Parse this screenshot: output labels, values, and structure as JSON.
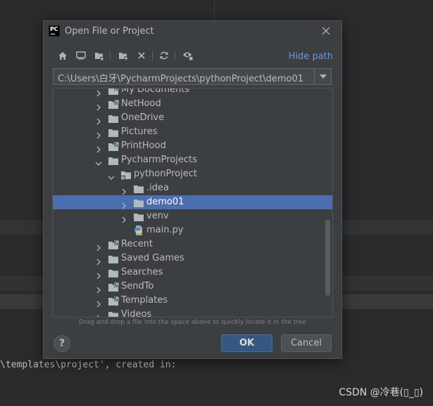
{
  "console": {
    "line": "\\templates\\project', created in:"
  },
  "watermark": "CSDN @冷巷(▯_▯)",
  "dialog": {
    "title": "Open File or Project",
    "logo_text": "PC",
    "hide_path_label": "Hide path",
    "path_value": "C:\\Users\\白牙\\PycharmProjects\\pythonProject\\demo01",
    "tree_hint": "Drag and drop a file into the space above to quickly locate it in the tree",
    "ok_label": "OK",
    "cancel_label": "Cancel",
    "help_label": "?"
  },
  "tree": {
    "items": [
      {
        "label": "My Documents",
        "icon": "folder-link-icon",
        "expanded": false
      },
      {
        "label": "NetHood",
        "icon": "folder-link-icon",
        "expanded": false
      },
      {
        "label": "OneDrive",
        "icon": "folder-icon",
        "expanded": false
      },
      {
        "label": "Pictures",
        "icon": "folder-icon",
        "expanded": false
      },
      {
        "label": "PrintHood",
        "icon": "folder-link-icon",
        "expanded": false
      },
      {
        "label": "PycharmProjects",
        "icon": "folder-icon",
        "expanded": true
      },
      {
        "label": "pythonProject",
        "icon": "project-folder-icon",
        "expanded": true
      },
      {
        "label": ".idea",
        "icon": "folder-icon",
        "expanded": false
      },
      {
        "label": "demo01",
        "icon": "folder-icon",
        "expanded": false,
        "selected": true
      },
      {
        "label": "venv",
        "icon": "folder-icon",
        "expanded": false
      },
      {
        "label": "main.py",
        "icon": "python-file-icon"
      },
      {
        "label": "Recent",
        "icon": "folder-link-icon",
        "expanded": false
      },
      {
        "label": "Saved Games",
        "icon": "folder-icon",
        "expanded": false
      },
      {
        "label": "Searches",
        "icon": "folder-icon",
        "expanded": false
      },
      {
        "label": "SendTo",
        "icon": "folder-link-icon",
        "expanded": false
      },
      {
        "label": "Templates",
        "icon": "folder-link-icon",
        "expanded": false
      },
      {
        "label": "Videos",
        "icon": "folder-icon",
        "expanded": false
      }
    ]
  },
  "toolbar": {
    "icons": [
      "home-icon",
      "desktop-icon",
      "project-dir-icon",
      "new-folder-icon",
      "delete-icon",
      "refresh-icon",
      "show-hidden-icon"
    ]
  },
  "colors": {
    "selection": "#4b6eaf",
    "link": "#589df6",
    "dialog_bg": "#3c3f41",
    "ok_button": "#365880"
  }
}
